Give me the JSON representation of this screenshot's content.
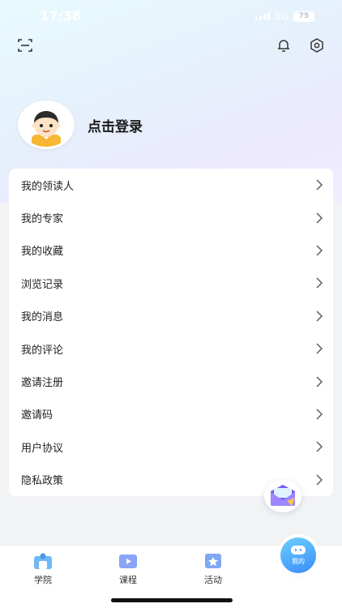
{
  "status_bar": {
    "time": "17:38",
    "network": "5G",
    "battery": "75"
  },
  "header": {
    "scan_icon": "scan-icon",
    "bell_icon": "bell-icon",
    "settings_icon": "settings-hex-icon"
  },
  "profile": {
    "login_text": "点击登录"
  },
  "menu": {
    "items": [
      {
        "label": "我的领读人"
      },
      {
        "label": "我的专家"
      },
      {
        "label": "我的收藏"
      },
      {
        "label": "浏览记录"
      },
      {
        "label": "我的消息"
      },
      {
        "label": "我的评论"
      },
      {
        "label": "邀请注册"
      },
      {
        "label": "邀请码"
      },
      {
        "label": "用户协议"
      },
      {
        "label": "隐私政策"
      }
    ]
  },
  "tabbar": {
    "tabs": [
      {
        "label": "学院"
      },
      {
        "label": "课程"
      },
      {
        "label": "活动"
      },
      {
        "label": "我的"
      }
    ]
  },
  "colors": {
    "accent": "#3b8cf7",
    "hero_start": "#e8fbff",
    "hero_end": "#f0eefc",
    "background": "#f2f3f5"
  }
}
